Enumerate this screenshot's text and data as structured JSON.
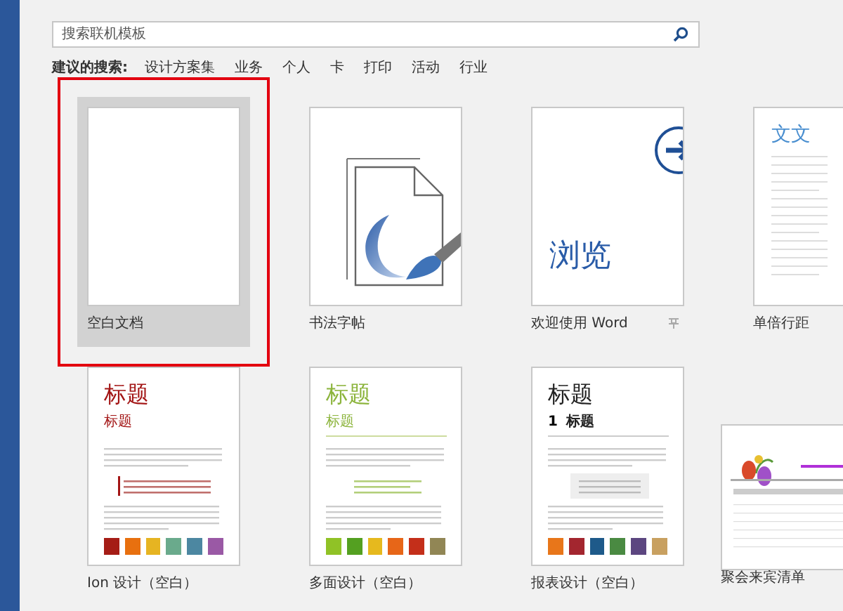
{
  "search": {
    "placeholder": "搜索联机模板"
  },
  "suggested": {
    "label": "建议的搜索:",
    "items": [
      "设计方案集",
      "业务",
      "个人",
      "卡",
      "打印",
      "活动",
      "行业"
    ]
  },
  "templates": [
    {
      "label": "空白文档",
      "selected": true,
      "kind": "blank"
    },
    {
      "label": "书法字帖",
      "selected": false,
      "kind": "calligraphy"
    },
    {
      "label": "欢迎使用 Word",
      "selected": false,
      "kind": "welcome",
      "thumb_text": "浏览",
      "pinned": false
    },
    {
      "label": "单倍行距",
      "selected": false,
      "kind": "spacing",
      "thumb_text": "文文"
    },
    {
      "label": "Ion 设计（空白）",
      "selected": false,
      "kind": "ion",
      "title": "标题",
      "subtitle": "标题",
      "swatches": [
        {
          "color": "#a51d16"
        },
        {
          "color": "#e8700f"
        },
        {
          "color": "#e6b422"
        },
        {
          "color": "#6aaa8c"
        },
        {
          "color": "#4c87a1"
        },
        {
          "color": "#9a59a5"
        }
      ]
    },
    {
      "label": "多面设计（空白）",
      "selected": false,
      "kind": "facet",
      "title": "标题",
      "subtitle": "标题",
      "swatches": [
        {
          "color": "#90c226"
        },
        {
          "color": "#54a021"
        },
        {
          "color": "#e6b91e"
        },
        {
          "color": "#e76618"
        },
        {
          "color": "#c42f1a"
        },
        {
          "color": "#918655"
        }
      ]
    },
    {
      "label": "报表设计（空白）",
      "selected": false,
      "kind": "report",
      "title": "标题",
      "number": "1",
      "subtitle": "标题",
      "swatches": [
        {
          "color": "#e8761a"
        },
        {
          "color": "#a3262f"
        },
        {
          "color": "#1e5a8a"
        },
        {
          "color": "#4a8a42"
        },
        {
          "color": "#5c4680"
        },
        {
          "color": "#c8a060"
        }
      ]
    },
    {
      "label": "聚会来宾清单",
      "selected": false,
      "kind": "party"
    }
  ]
}
